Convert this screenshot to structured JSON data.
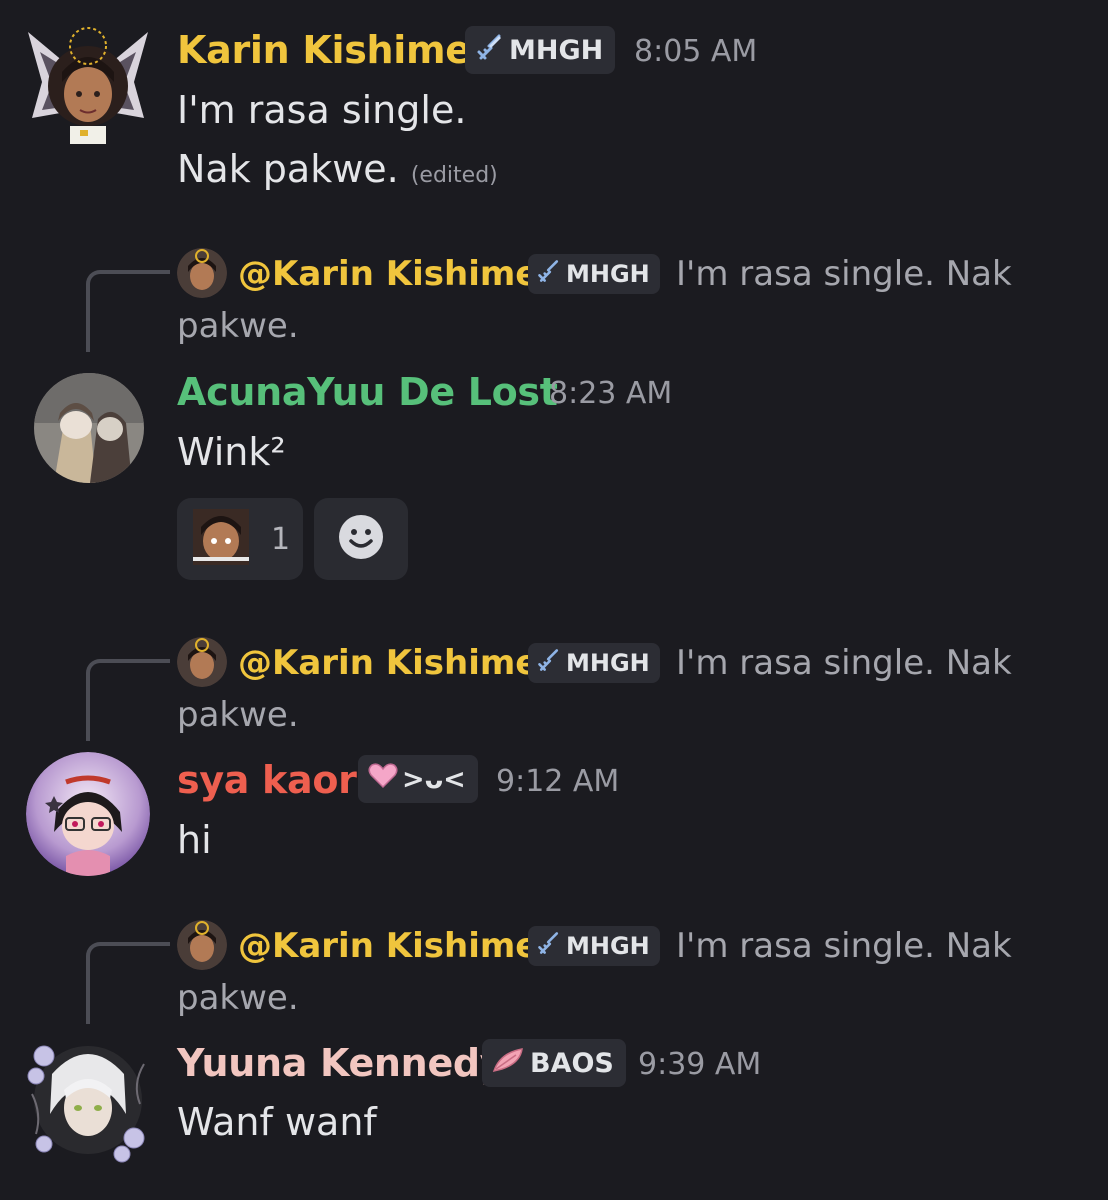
{
  "colors": {
    "background": "#1b1b20",
    "karin": "#f0c53d",
    "acuna": "#57c07a",
    "sya": "#ee5f4f",
    "yuuna": "#f2c6c0"
  },
  "messages": [
    {
      "author": "Karin Kishimei",
      "tag": "MHGH",
      "tag_icon": "sword-icon",
      "time": "8:05 AM",
      "lines": [
        "I'm rasa single.",
        "Nak pakwe."
      ],
      "edited": "(edited)"
    },
    {
      "reply": {
        "mention": "@Karin Kishimei",
        "tag": "MHGH",
        "text_line1": "I'm rasa single. Nak",
        "text_line2": "pakwe."
      },
      "author": "AcunaYuu De Lost",
      "time": "8:23 AM",
      "lines": [
        "Wink²"
      ],
      "reactions": [
        {
          "count": "1"
        }
      ]
    },
    {
      "reply": {
        "mention": "@Karin Kishimei",
        "tag": "MHGH",
        "text_line1": "I'm rasa single. Nak",
        "text_line2": "pakwe."
      },
      "author": "sya kaori",
      "tag": ">ᴗ<",
      "tag_icon": "pink-heart-icon",
      "time": "9:12 AM",
      "lines": [
        "hi"
      ]
    },
    {
      "reply": {
        "mention": "@Karin Kishimei",
        "tag": "MHGH",
        "text_line1": "I'm rasa single. Nak",
        "text_line2": "pakwe."
      },
      "author": "Yuuna Kennedy",
      "tag": "BAOS",
      "tag_icon": "pink-feather-icon",
      "time": "9:39 AM",
      "lines": [
        "Wanf wanf"
      ]
    }
  ]
}
